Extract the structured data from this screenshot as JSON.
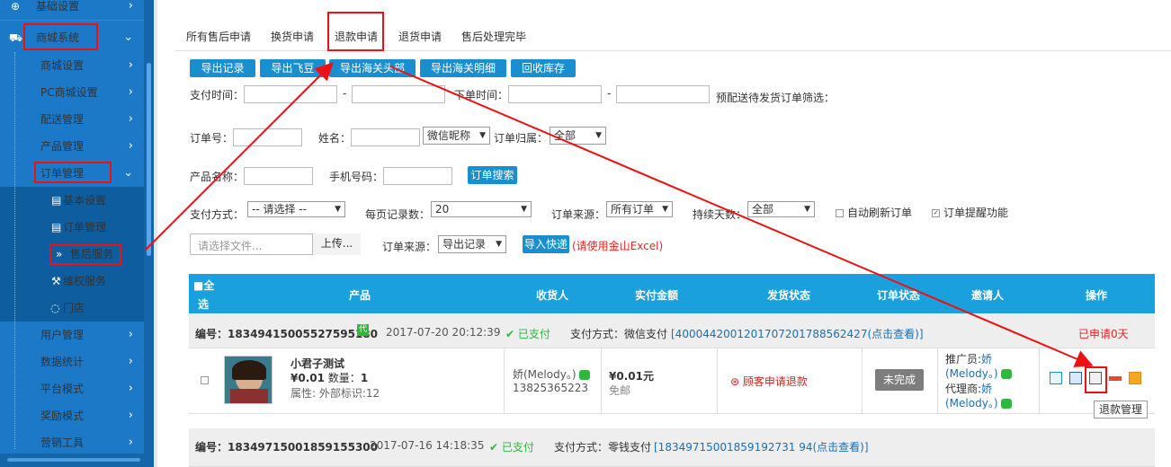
{
  "sidebar": {
    "items": [
      {
        "label": "基础设置",
        "icon": "globe-icon"
      },
      {
        "label": "商城系统",
        "icon": "cart-icon"
      },
      {
        "label": "商城设置"
      },
      {
        "label": "PC商城设置"
      },
      {
        "label": "配送管理"
      },
      {
        "label": "产品管理"
      },
      {
        "label": "订单管理"
      },
      {
        "label": "基本设置"
      },
      {
        "label": "订单管理"
      },
      {
        "label": "售后服务"
      },
      {
        "label": "维权服务"
      },
      {
        "label": "门店"
      },
      {
        "label": "用户管理"
      },
      {
        "label": "数据统计"
      },
      {
        "label": "平台模式"
      },
      {
        "label": "奖励模式"
      },
      {
        "label": "营销工具"
      }
    ]
  },
  "tabs": [
    "所有售后申请",
    "换货申请",
    "退款申请",
    "退货申请",
    "售后处理完毕"
  ],
  "toolbar": [
    "导出记录",
    "导出飞豆",
    "导出海关头部",
    "导出海关明细",
    "回收库存"
  ],
  "filters": {
    "pay_time": "支付时间：",
    "dash": "-",
    "order_time": "下单时间：",
    "pre_dispatch": "预配送待发货订单筛选：",
    "order_no": "订单号：",
    "name": "姓名：",
    "wechat_nick": "微信昵称",
    "order_owner": "订单归属：",
    "owner_value": "全部",
    "product_name": "产品名称：",
    "phone": "手机号码：",
    "search_btn": "订单搜索",
    "pay_method": "支付方式：",
    "pay_method_value": "-- 请选择 --",
    "per_page": "每页记录数：",
    "per_page_value": "20",
    "order_source": "订单来源：",
    "order_source_value": "所有订单",
    "keep_days": "持续天数：",
    "keep_days_value": "全部",
    "auto_refresh": "自动刷新订单",
    "order_remind": "订单提醒功能"
  },
  "upload": {
    "placeholder": "请选择文件...",
    "upload_btn": "上传...",
    "source_label": "订单来源：",
    "source_value": "导出记录",
    "import_btn": "导入快递",
    "hint": "(请使用金山Excel)"
  },
  "table": {
    "headers": [
      "全",
      "选",
      "产品",
      "收货人",
      "实付金额",
      "发货状态",
      "订单状态",
      "邀请人",
      "操作"
    ],
    "orders": [
      {
        "no_label": "编号：",
        "no": "18349415005527595180",
        "badge": "代",
        "time": "2017-07-20 20:12:39",
        "paid": "已支付",
        "pay_method": "支付方式：微信支付",
        "txn": "[4000442001201707201788562427(点击查看)]",
        "applied": "已申请0天"
      },
      {
        "no_label": "编号：",
        "no": "18349715001859155300",
        "time": "2017-07-16 14:18:35",
        "paid": "已支付",
        "pay_method": "支付方式：零钱支付",
        "txn": "[18349715001859192731 94(点击查看)]"
      }
    ],
    "product": {
      "name": "小君子测试",
      "price": "¥0.01",
      "qty_label": "数量：",
      "qty": "1",
      "attr": "属性: 外部标识:12",
      "receiver": "娇(Melody。)",
      "phone": "13825365223",
      "amount": "¥0.01元",
      "shipping": "免邮",
      "status": "顾客申请退款",
      "order_status": "未完成",
      "promoter_label": "推广员:",
      "promoter_name": "娇",
      "promoter_nick": "(Melody。)",
      "agent_label": "代理商:",
      "agent_name": "娇",
      "agent_nick": "(Melody。)"
    }
  },
  "tooltip": "退款管理"
}
